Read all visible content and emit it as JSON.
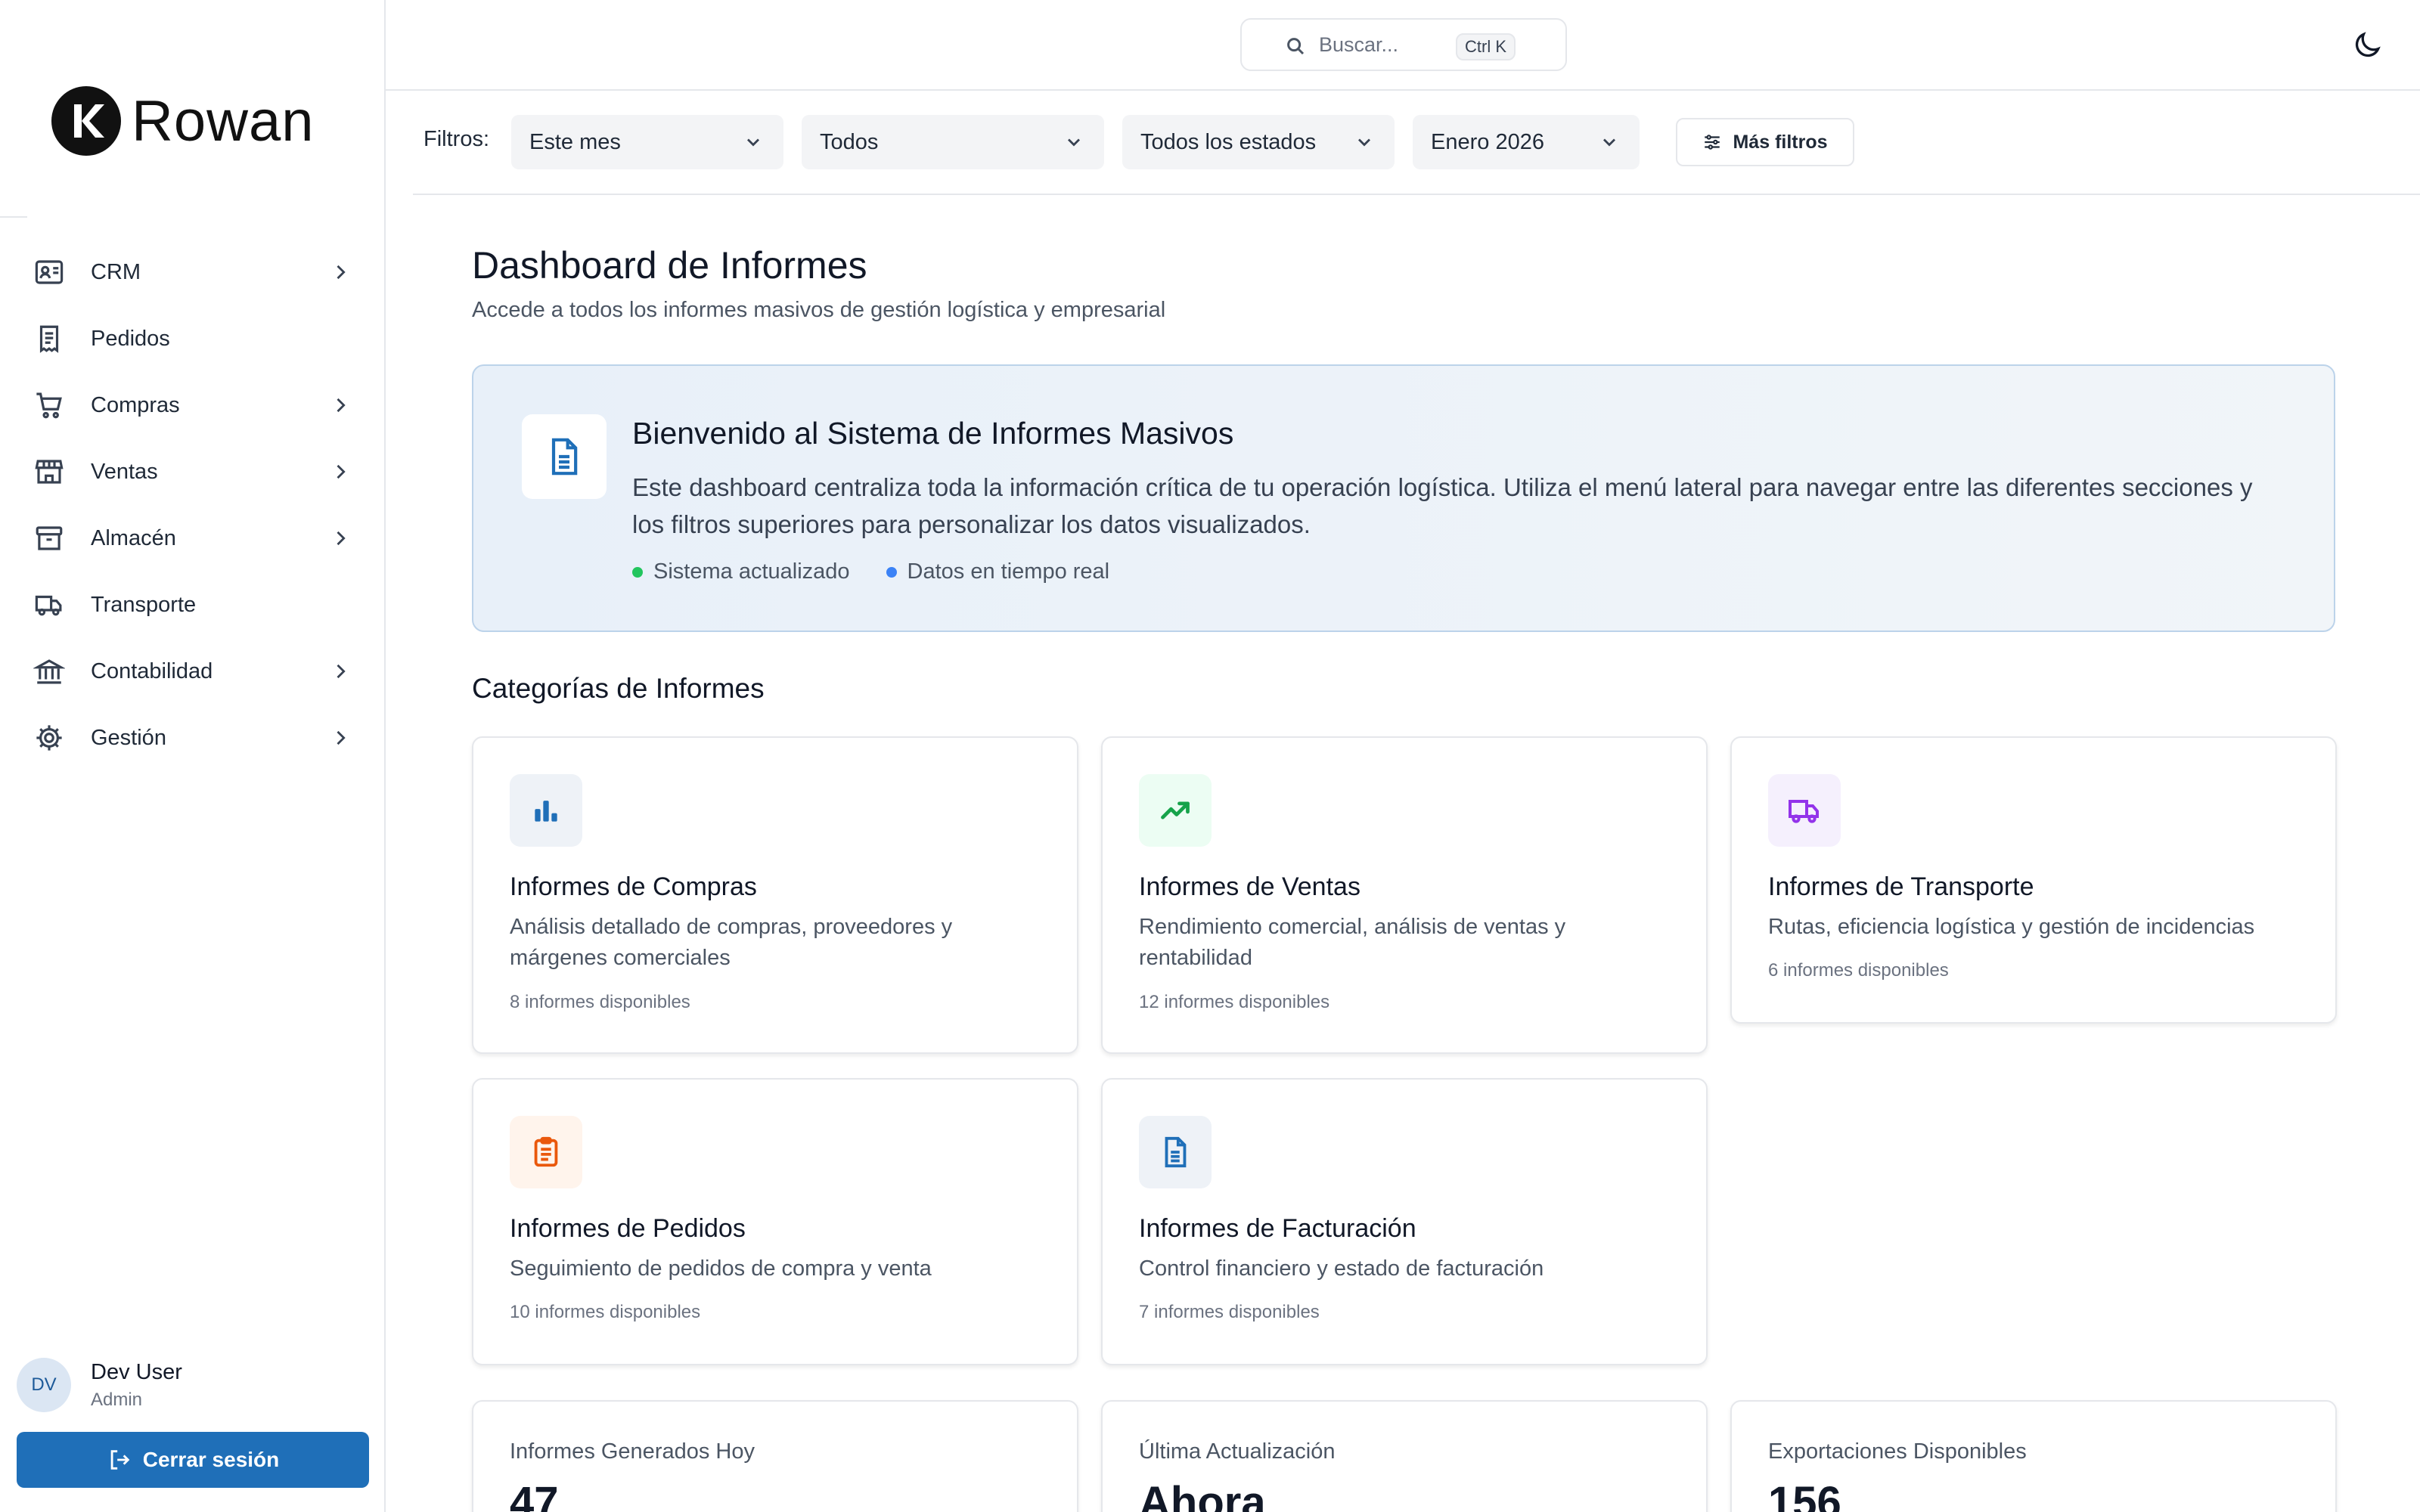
{
  "sidebar": {
    "logo_text": "Rowan",
    "items": [
      {
        "label": "CRM",
        "icon": "contact-card-icon",
        "has_submenu": true
      },
      {
        "label": "Pedidos",
        "icon": "receipt-icon",
        "has_submenu": false
      },
      {
        "label": "Compras",
        "icon": "cart-icon",
        "has_submenu": true
      },
      {
        "label": "Ventas",
        "icon": "store-icon",
        "has_submenu": true
      },
      {
        "label": "Almacén",
        "icon": "archive-icon",
        "has_submenu": true
      },
      {
        "label": "Transporte",
        "icon": "truck-icon",
        "has_submenu": false
      },
      {
        "label": "Contabilidad",
        "icon": "bank-icon",
        "has_submenu": true
      },
      {
        "label": "Gestión",
        "icon": "gear-icon",
        "has_submenu": true
      }
    ],
    "user": {
      "initials": "DV",
      "name": "Dev User",
      "role": "Admin"
    },
    "logout_label": "Cerrar sesión"
  },
  "topbar": {
    "search_placeholder": "Buscar...",
    "search_shortcut": "Ctrl K"
  },
  "filters": {
    "label": "Filtros:",
    "period": "Este mes",
    "scope": "Todos",
    "status": "Todos los estados",
    "month": "Enero 2026",
    "more_label": "Más filtros"
  },
  "main": {
    "title": "Dashboard de Informes",
    "subtitle": "Accede a todos los informes masivos de gestión logística y empresarial",
    "welcome": {
      "title": "Bienvenido al Sistema de Informes Masivos",
      "text": "Este dashboard centraliza toda la información crítica de tu operación logística. Utiliza el menú lateral para navegar entre las diferentes secciones y los filtros superiores para personalizar los datos visualizados.",
      "tag1": "Sistema actualizado",
      "tag2": "Datos en tiempo real"
    },
    "categories_title": "Categorías de Informes",
    "categories": [
      {
        "title": "Informes de Compras",
        "description": "Análisis detallado de compras, proveedores y márgenes comerciales",
        "count": "8 informes disponibles",
        "icon": "bar-chart-icon",
        "color": "#1f6fb8",
        "bg": "#eef2f7"
      },
      {
        "title": "Informes de Ventas",
        "description": "Rendimiento comercial, análisis de ventas y rentabilidad",
        "count": "12 informes disponibles",
        "icon": "trending-up-icon",
        "color": "#16a34a",
        "bg": "#ecfdf3"
      },
      {
        "title": "Informes de Transporte",
        "description": "Rutas, eficiencia logística y gestión de incidencias",
        "count": "6 informes disponibles",
        "icon": "truck-icon",
        "color": "#9333ea",
        "bg": "#f5f0fd"
      },
      {
        "title": "Informes de Pedidos",
        "description": "Seguimiento de pedidos de compra y venta",
        "count": "10 informes disponibles",
        "icon": "clipboard-icon",
        "color": "#ea580c",
        "bg": "#fff4ec"
      },
      {
        "title": "Informes de Facturación",
        "description": "Control financiero y estado de facturación",
        "count": "7 informes disponibles",
        "icon": "document-icon",
        "color": "#1f6fb8",
        "bg": "#eef2f7"
      }
    ],
    "stats": [
      {
        "label": "Informes Generados Hoy",
        "value": "47"
      },
      {
        "label": "Última Actualización",
        "value": "Ahora"
      },
      {
        "label": "Exportaciones Disponibles",
        "value": "156"
      }
    ]
  }
}
